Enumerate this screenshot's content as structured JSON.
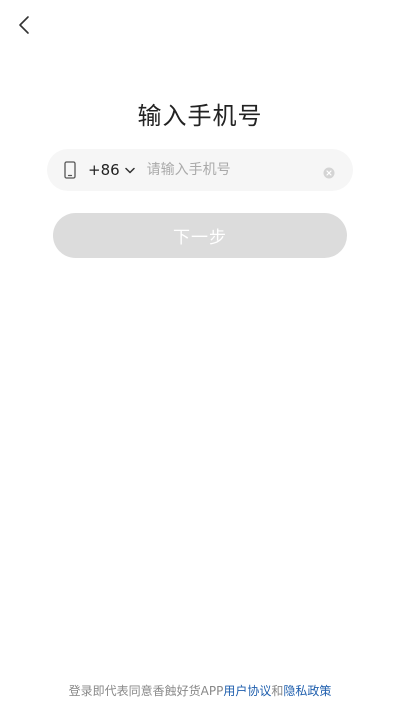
{
  "header": {
    "back_icon": "chevron-left-icon"
  },
  "main": {
    "title": "输入手机号",
    "phone": {
      "device_icon": "mobile-phone-icon",
      "country_code": "+86",
      "country_dropdown_icon": "chevron-down-icon",
      "placeholder": "请输入手机号",
      "value": "",
      "clear_icon": "clear-icon"
    },
    "next_button": {
      "label": "下一步",
      "enabled": false
    }
  },
  "footer": {
    "agreement_prefix": "登录即代表同意香蝕好货APP",
    "user_agreement": "用户协议",
    "connector": "和",
    "privacy_policy": "隐私政策"
  },
  "colors": {
    "background": "#ffffff",
    "input_background": "#f6f6f6",
    "button_disabled": "#dcdcdc",
    "link": "#1f5fae",
    "text_muted": "#888888"
  }
}
